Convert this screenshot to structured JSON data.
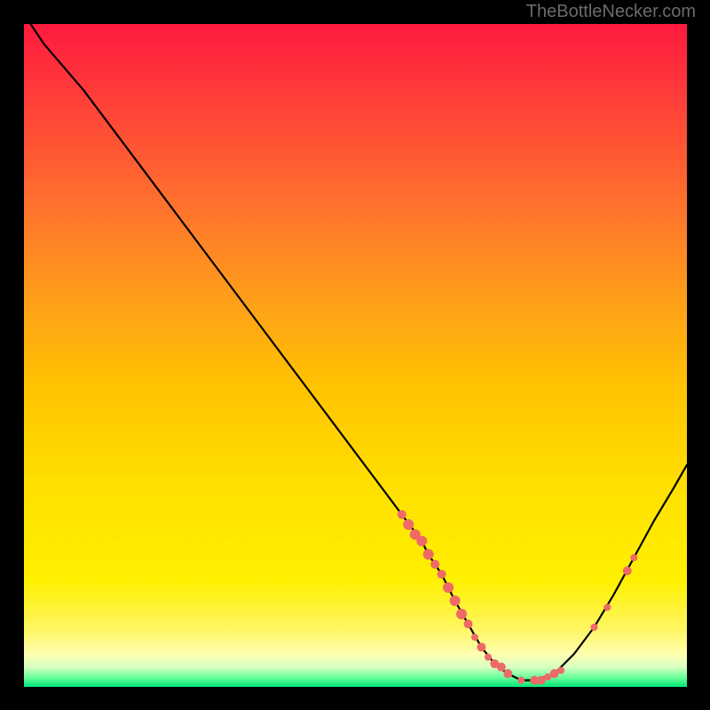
{
  "watermark": "TheBottleNecker.com",
  "chart_data": {
    "type": "line",
    "title": "",
    "xlabel": "",
    "ylabel": "",
    "xlim": [
      0,
      100
    ],
    "ylim": [
      0,
      100
    ],
    "legend": false,
    "grid": false,
    "background_gradient": {
      "top": "#ff1744",
      "middle": "#ffd600",
      "bottom_band": "#ffff8d",
      "bottom_edge": "#00e676"
    },
    "curve": {
      "name": "bottleneck-curve",
      "x": [
        1,
        3,
        6,
        9,
        12,
        15,
        18,
        21,
        24,
        27,
        30,
        33,
        36,
        39,
        42,
        45,
        48,
        51,
        54,
        57,
        60,
        61,
        63,
        65,
        67,
        69,
        71,
        73,
        75,
        77,
        80,
        83,
        86,
        89,
        92,
        95,
        98,
        100
      ],
      "y": [
        100,
        97,
        93.5,
        90,
        86,
        82,
        78,
        74,
        70,
        66,
        62,
        58,
        54,
        50,
        46,
        42,
        38,
        34,
        30,
        26,
        22,
        20,
        17,
        13,
        9.5,
        6,
        3.5,
        2,
        1,
        1,
        2,
        5,
        9,
        14,
        19.5,
        25,
        30,
        33.5
      ]
    },
    "markers": [
      {
        "x": 57,
        "y": 26,
        "r": 5
      },
      {
        "x": 58,
        "y": 24.5,
        "r": 6
      },
      {
        "x": 59,
        "y": 23,
        "r": 6
      },
      {
        "x": 60,
        "y": 22,
        "r": 6
      },
      {
        "x": 61,
        "y": 20,
        "r": 6
      },
      {
        "x": 62,
        "y": 18.5,
        "r": 5
      },
      {
        "x": 63,
        "y": 17,
        "r": 5
      },
      {
        "x": 64,
        "y": 15,
        "r": 6
      },
      {
        "x": 65,
        "y": 13,
        "r": 6
      },
      {
        "x": 66,
        "y": 11,
        "r": 6
      },
      {
        "x": 67,
        "y": 9.5,
        "r": 5
      },
      {
        "x": 68,
        "y": 7.5,
        "r": 4
      },
      {
        "x": 69,
        "y": 6,
        "r": 5
      },
      {
        "x": 70,
        "y": 4.5,
        "r": 4
      },
      {
        "x": 71,
        "y": 3.5,
        "r": 5
      },
      {
        "x": 72,
        "y": 3,
        "r": 5
      },
      {
        "x": 73,
        "y": 2,
        "r": 5
      },
      {
        "x": 75,
        "y": 1,
        "r": 4
      },
      {
        "x": 77,
        "y": 1,
        "r": 5
      },
      {
        "x": 78,
        "y": 1,
        "r": 5
      },
      {
        "x": 79,
        "y": 1.5,
        "r": 4
      },
      {
        "x": 80,
        "y": 2,
        "r": 5
      },
      {
        "x": 81,
        "y": 2.5,
        "r": 4
      },
      {
        "x": 86,
        "y": 9,
        "r": 4
      },
      {
        "x": 88,
        "y": 12,
        "r": 4
      },
      {
        "x": 91,
        "y": 17.5,
        "r": 5
      },
      {
        "x": 92,
        "y": 19.5,
        "r": 4
      }
    ]
  }
}
